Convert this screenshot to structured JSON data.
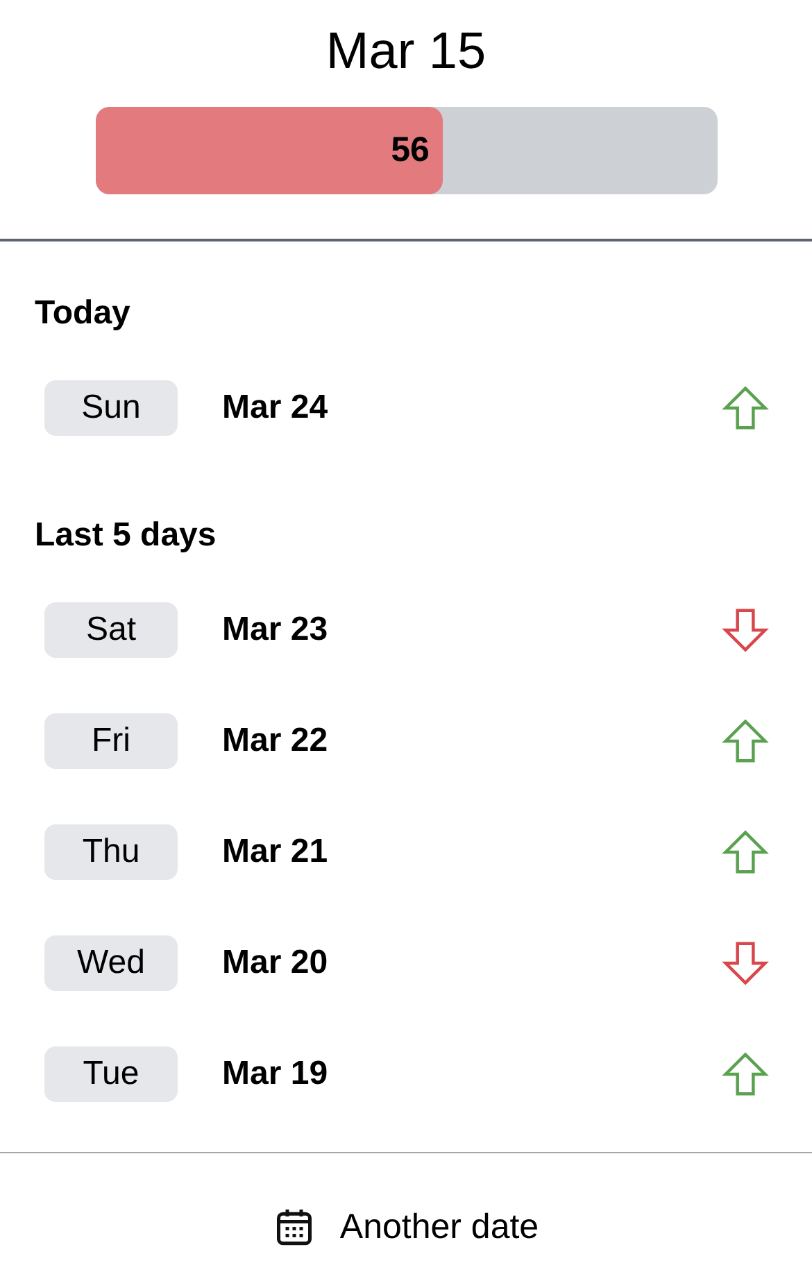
{
  "header": {
    "title": "Mar 15",
    "progress": {
      "level": 0.56,
      "value": "56"
    }
  },
  "sections": [
    {
      "heading": "Today",
      "days": [
        {
          "weekday": "Sun",
          "date": "Mar 24",
          "kind": "up"
        }
      ]
    },
    {
      "heading": "Last 5 days",
      "days": [
        {
          "weekday": "Sat",
          "date": "Mar 23",
          "kind": "down"
        },
        {
          "weekday": "Fri",
          "date": "Mar 22",
          "kind": "up"
        },
        {
          "weekday": "Thu",
          "date": "Mar 21",
          "kind": "up"
        },
        {
          "weekday": "Wed",
          "date": "Mar 20",
          "kind": "down"
        },
        {
          "weekday": "Tue",
          "date": "Mar 19",
          "kind": "up"
        }
      ]
    }
  ],
  "footer": {
    "button": "Another date"
  }
}
